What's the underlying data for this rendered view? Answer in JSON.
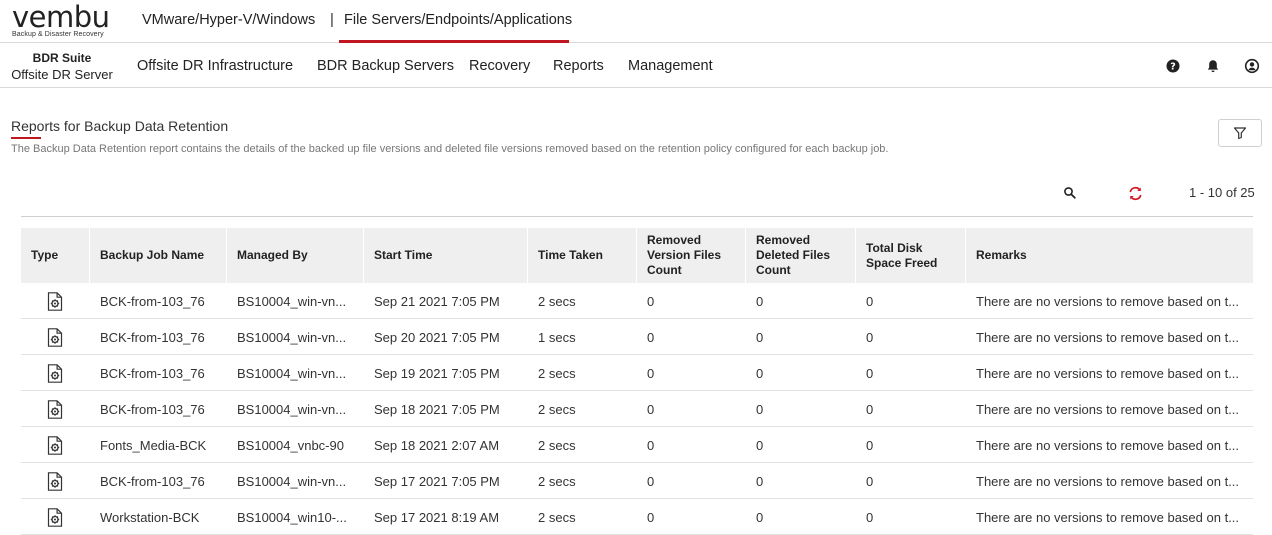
{
  "logo": {
    "word": "vembu",
    "tagline": "Backup & Disaster Recovery"
  },
  "product_tabs": [
    {
      "label": "VMware/Hyper-V/Windows"
    },
    {
      "label": "File Servers/Endpoints/Applications",
      "active": true
    }
  ],
  "separator": "|",
  "brand": {
    "title": "BDR Suite",
    "subtitle": "Offsite DR Server"
  },
  "nav": [
    {
      "label": "Offsite DR Infrastructure"
    },
    {
      "label": "BDR Backup Servers"
    },
    {
      "label": "Recovery"
    },
    {
      "label": "Reports"
    },
    {
      "label": "Management"
    }
  ],
  "header_icons": [
    "help-icon",
    "bell-icon",
    "user-icon"
  ],
  "page": {
    "title": "Reports for Backup Data Retention",
    "description": "The Backup Data Retention report contains the details of the backed up file versions and deleted file versions removed based on the retention policy configured for each backup job."
  },
  "toolbar": {
    "pagination": "1 - 10 of 25"
  },
  "table": {
    "columns": [
      "Type",
      "Backup Job Name",
      "Managed By",
      "Start Time",
      "Time Taken",
      "Removed Version Files Count",
      "Removed Deleted Files Count",
      "Total Disk Space Freed",
      "Remarks"
    ],
    "rows": [
      {
        "job": "BCK-from-103_76",
        "managed": "BS10004_win-vn...",
        "start": "Sep 21 2021 7:05 PM",
        "taken": "2 secs",
        "rv": "0",
        "rd": "0",
        "freed": "0",
        "remarks": "There are no versions to remove based on t..."
      },
      {
        "job": "BCK-from-103_76",
        "managed": "BS10004_win-vn...",
        "start": "Sep 20 2021 7:05 PM",
        "taken": "1 secs",
        "rv": "0",
        "rd": "0",
        "freed": "0",
        "remarks": "There are no versions to remove based on t..."
      },
      {
        "job": "BCK-from-103_76",
        "managed": "BS10004_win-vn...",
        "start": "Sep 19 2021 7:05 PM",
        "taken": "2 secs",
        "rv": "0",
        "rd": "0",
        "freed": "0",
        "remarks": "There are no versions to remove based on t..."
      },
      {
        "job": "BCK-from-103_76",
        "managed": "BS10004_win-vn...",
        "start": "Sep 18 2021 7:05 PM",
        "taken": "2 secs",
        "rv": "0",
        "rd": "0",
        "freed": "0",
        "remarks": "There are no versions to remove based on t..."
      },
      {
        "job": "Fonts_Media-BCK",
        "managed": "BS10004_vnbc-90",
        "start": "Sep 18 2021 2:07 AM",
        "taken": "2 secs",
        "rv": "0",
        "rd": "0",
        "freed": "0",
        "remarks": "There are no versions to remove based on t..."
      },
      {
        "job": "BCK-from-103_76",
        "managed": "BS10004_win-vn...",
        "start": "Sep 17 2021 7:05 PM",
        "taken": "2 secs",
        "rv": "0",
        "rd": "0",
        "freed": "0",
        "remarks": "There are no versions to remove based on t..."
      },
      {
        "job": "Workstation-BCK",
        "managed": "BS10004_win10-...",
        "start": "Sep 17 2021 8:19 AM",
        "taken": "2 secs",
        "rv": "0",
        "rd": "0",
        "freed": "0",
        "remarks": "There are no versions to remove based on t..."
      }
    ]
  },
  "colors": {
    "accent": "#c0161f",
    "header_bg": "#efefef"
  }
}
